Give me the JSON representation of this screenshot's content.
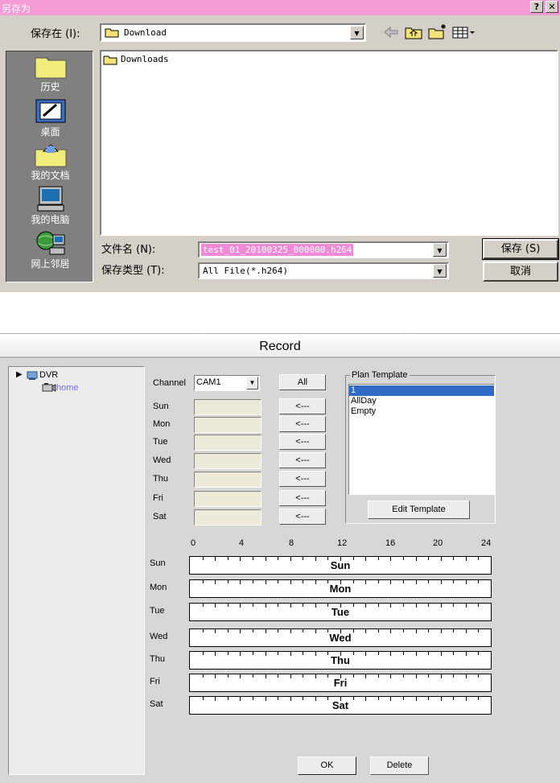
{
  "save_dialog": {
    "title": "另存为",
    "help_button": "?",
    "close_button": "✕",
    "save_in_label": "保存在 (I):",
    "save_in_value": "Download",
    "toolbar_icons": [
      "back-arrow-icon",
      "up-folder-icon",
      "new-folder-icon",
      "view-menu-icon"
    ],
    "files": [
      {
        "name": "Downloads",
        "icon": "folder-icon"
      }
    ],
    "places": [
      {
        "label": "历史",
        "icon": "history-folder-icon"
      },
      {
        "label": "桌面",
        "icon": "desktop-icon"
      },
      {
        "label": "我的文档",
        "icon": "my-documents-icon"
      },
      {
        "label": "我的电脑",
        "icon": "my-computer-icon"
      },
      {
        "label": "网上邻居",
        "icon": "network-places-icon"
      }
    ],
    "filename_label": "文件名 (N):",
    "filename_value": "test_01_20100325_000000.h264",
    "filetype_label": "保存类型 (T):",
    "filetype_value": "All File(*.h264)",
    "save_button": "保存 (S)",
    "cancel_button": "取消",
    "colors": {
      "title_bar": "#f59bd6",
      "selection": "#f08ad8",
      "dialog_face": "#d4d0c8"
    }
  },
  "record": {
    "title": "Record",
    "tree": {
      "root": "DVR",
      "child": "home"
    },
    "channel_label": "Channel",
    "channel_value": "CAM1",
    "all_button": "All",
    "day_rows": [
      {
        "label": "Sun",
        "button": "<---"
      },
      {
        "label": "Mon",
        "button": "<---"
      },
      {
        "label": "Tue",
        "button": "<---"
      },
      {
        "label": "Wed",
        "button": "<---"
      },
      {
        "label": "Thu",
        "button": "<---"
      },
      {
        "label": "Fri",
        "button": "<---"
      },
      {
        "label": "Sat",
        "button": "<---"
      }
    ],
    "plan_template": {
      "legend": "Plan Template",
      "items": [
        "1",
        "AllDay",
        "Empty"
      ],
      "selected_index": 0,
      "edit_button": "Edit Template"
    },
    "timeline": {
      "hour_labels": [
        "0",
        "4",
        "8",
        "12",
        "16",
        "20",
        "24"
      ],
      "rows": [
        {
          "label": "Sun",
          "bar": "Sun"
        },
        {
          "label": "Mon",
          "bar": "Mon"
        },
        {
          "label": "Tue",
          "bar": "Tue"
        },
        {
          "label": "Wed",
          "bar": "Wed"
        },
        {
          "label": "Thu",
          "bar": "Thu"
        },
        {
          "label": "Fri",
          "bar": "Fri"
        },
        {
          "label": "Sat",
          "bar": "Sat"
        }
      ]
    },
    "ok_button": "OK",
    "delete_button": "Delete",
    "colors": {
      "selection": "#316ac5",
      "window_bg": "#d7d7d7"
    }
  }
}
